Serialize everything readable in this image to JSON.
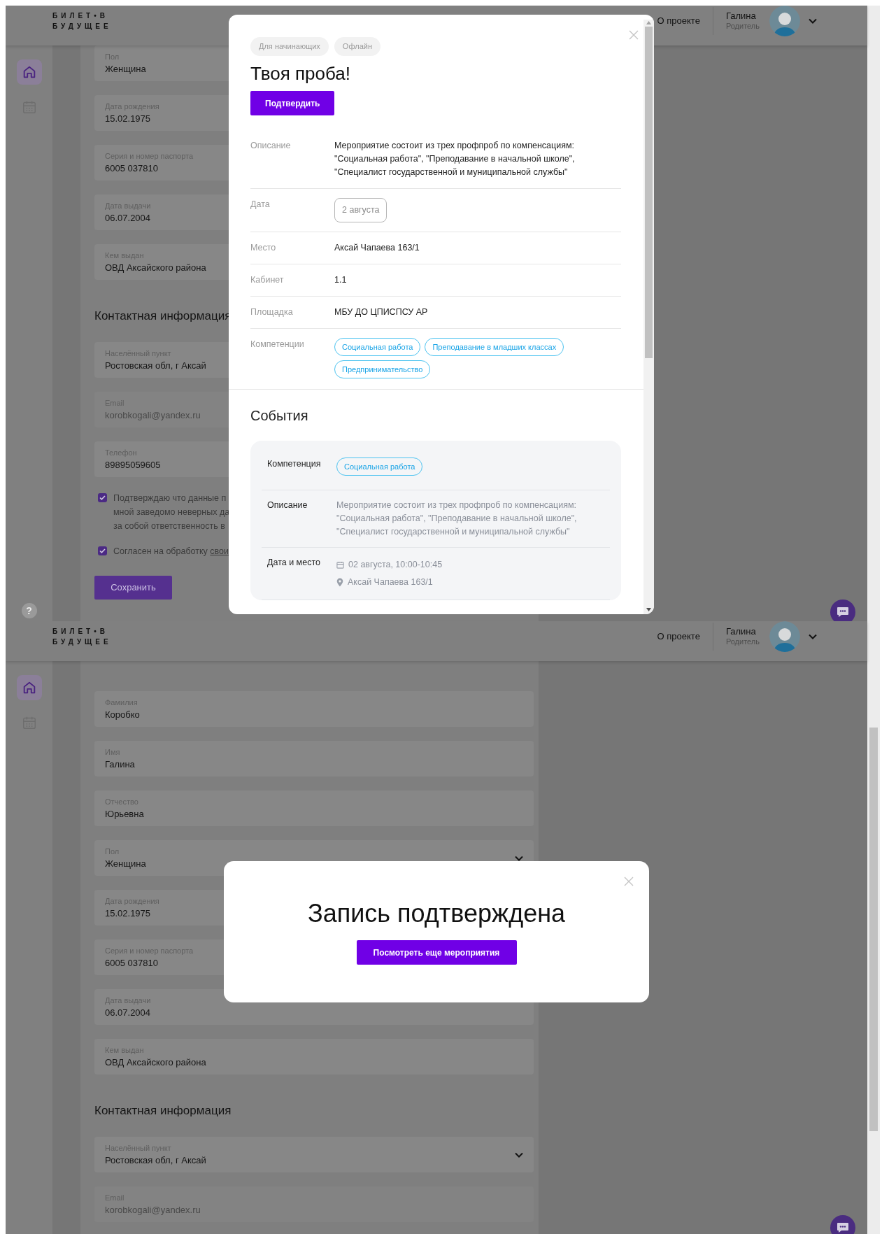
{
  "screens": [
    {
      "header": {
        "logo_lines": [
          "БИЛЕТ•В",
          "БУДУЩЕЕ"
        ],
        "nav_link": "О проекте",
        "user_name": "Галина",
        "user_role": "Родитель"
      },
      "sidebar": {
        "items": [
          {
            "kind": "home",
            "selected": true
          },
          {
            "kind": "calendar",
            "selected": false
          }
        ]
      },
      "help": "?",
      "form": [
        {
          "kind": "field",
          "label": "Пол",
          "value": "Женщина",
          "disabled": false
        },
        {
          "kind": "field",
          "label": "Дата рождения",
          "value": "15.02.1975",
          "disabled": false
        },
        {
          "kind": "field",
          "label": "Серия и номер паспорта",
          "value": "6005 037810",
          "disabled": false
        },
        {
          "kind": "field",
          "label": "Дата выдачи",
          "value": "06.07.2004",
          "disabled": false
        },
        {
          "kind": "field",
          "label": "Кем выдан",
          "value": "ОВД Аксайского района",
          "disabled": false
        },
        {
          "kind": "heading",
          "text": "Контактная информация"
        },
        {
          "kind": "field",
          "label": "Населённый пункт",
          "value": "Ростовская обл, г Аксай",
          "disabled": false
        },
        {
          "kind": "field",
          "label": "Email",
          "value": "korobkogali@yandex.ru",
          "disabled": true
        },
        {
          "kind": "field",
          "label": "Телефон",
          "value": "89895059605",
          "disabled": false
        },
        {
          "kind": "checkbox",
          "checked": true,
          "text": "Подтверждаю что данные п\nмной заведомо неверных да\nза собой ответственность в"
        },
        {
          "kind": "checkbox",
          "checked": true,
          "text": "Согласен на обработку",
          "link": "свои"
        },
        {
          "kind": "button",
          "label": "Сохранить"
        }
      ],
      "modal": {
        "kind": "event",
        "tags": [
          "Для начинающих",
          "Офлайн"
        ],
        "title": "Твоя проба!",
        "confirm_button": "Подтвердить",
        "details": [
          {
            "kind": "text",
            "label": "Описание",
            "value": "Мероприятие состоит из трех профпроб по компенсациям: \"Социальная работа\", \"Преподавание в начальной школе\", \"Специалист государственной и муниципальной службы\""
          },
          {
            "kind": "date",
            "label": "Дата",
            "value": "2 августа"
          },
          {
            "kind": "text",
            "label": "Место",
            "value": "Аксай Чапаева 163/1"
          },
          {
            "kind": "text",
            "label": "Кабинет",
            "value": "1.1"
          },
          {
            "kind": "text",
            "label": "Площадка",
            "value": "МБУ ДО ЦПИСПСУ АР"
          },
          {
            "kind": "tags",
            "label": "Компетенции",
            "values": [
              "Социальная работа",
              "Преподавание в младших классах",
              "Предпринимательство"
            ]
          }
        ],
        "events_title": "События",
        "event_rows": [
          {
            "kind": "tags",
            "label": "Компетенция",
            "values": [
              "Социальная работа"
            ]
          },
          {
            "kind": "muted",
            "label": "Описание",
            "value": "Мероприятие состоит из трех профпроб по компенсациям: \"Социальная работа\", \"Преподавание в начальной школе\", \"Специалист государственной и муниципальной службы\""
          },
          {
            "kind": "date_place",
            "label": "Дата и место",
            "date": "02 августа, 10:00-10:45",
            "place": "Аксай Чапаева 163/1"
          }
        ]
      }
    },
    {
      "header": {
        "logo_lines": [
          "БИЛЕТ•В",
          "БУДУЩЕЕ"
        ],
        "nav_link": "О проекте",
        "user_name": "Галина",
        "user_role": "Родитель"
      },
      "sidebar": {
        "items": [
          {
            "kind": "home",
            "selected": true
          },
          {
            "kind": "calendar",
            "selected": false
          }
        ]
      },
      "form": [
        {
          "kind": "field",
          "label": "Фамилия",
          "value": "Коробко",
          "disabled": false
        },
        {
          "kind": "field",
          "label": "Имя",
          "value": "Галина",
          "disabled": false
        },
        {
          "kind": "field",
          "label": "Отчество",
          "value": "Юрьевна",
          "disabled": false
        },
        {
          "kind": "select",
          "label": "Пол",
          "value": "Женщина",
          "disabled": false
        },
        {
          "kind": "field",
          "label": "Дата рождения",
          "value": "15.02.1975",
          "disabled": false
        },
        {
          "kind": "field",
          "label": "Серия и номер паспорта",
          "value": "6005 037810",
          "disabled": false
        },
        {
          "kind": "field",
          "label": "Дата выдачи",
          "value": "06.07.2004",
          "disabled": false
        },
        {
          "kind": "field",
          "label": "Кем выдан",
          "value": "ОВД Аксайского района",
          "disabled": false
        },
        {
          "kind": "heading",
          "text": "Контактная информация"
        },
        {
          "kind": "select",
          "label": "Населённый пункт",
          "value": "Ростовская обл, г Аксай",
          "disabled": false
        },
        {
          "kind": "field",
          "label": "Email",
          "value": "korobkogali@yandex.ru",
          "disabled": true
        }
      ],
      "modal": {
        "kind": "confirmation",
        "title": "Запись подтверждена",
        "button": "Посмотреть еще мероприятия"
      }
    }
  ]
}
